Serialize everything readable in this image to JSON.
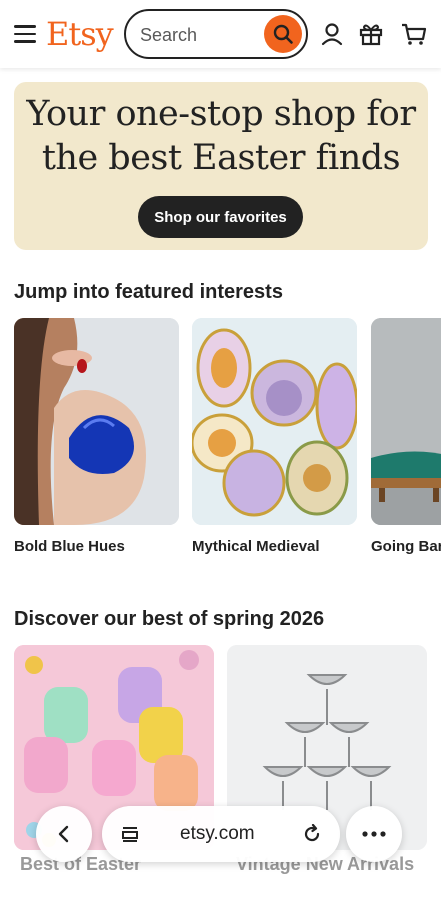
{
  "header": {
    "logo": "Etsy",
    "search_placeholder": "Search",
    "icons": [
      "menu-icon",
      "search-icon",
      "account-icon",
      "gift-icon",
      "cart-icon"
    ],
    "accent_color": "#f1641e"
  },
  "hero": {
    "title_line1": "Your one-stop shop for",
    "title_line2": "the best Easter finds",
    "button_label": "Shop our favorites",
    "background_color": "#f2e8cc"
  },
  "interests": {
    "title": "Jump into featured interests",
    "items": [
      {
        "label": "Bold Blue Hues"
      },
      {
        "label": "Mythical Medieval"
      },
      {
        "label": "Going Bar"
      }
    ]
  },
  "spring": {
    "title": "Discover our best of spring 2026",
    "items": [
      {
        "label": "Best of Easter"
      },
      {
        "label": "Vintage New Arrivals"
      }
    ]
  },
  "browser": {
    "url": "etsy.com",
    "icons": [
      "back-icon",
      "tabs-icon",
      "reload-icon",
      "more-icon"
    ]
  }
}
